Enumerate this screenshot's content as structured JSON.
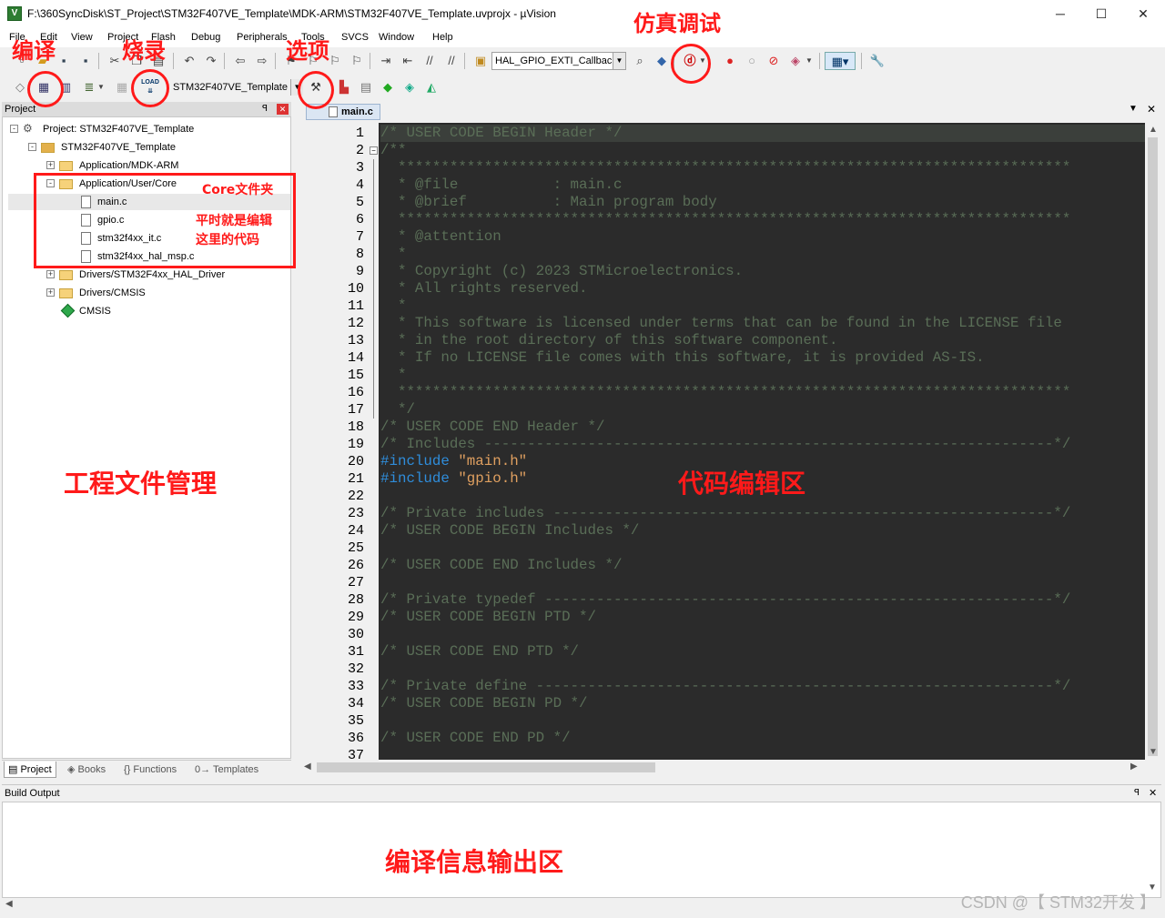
{
  "window": {
    "title": "F:\\360SyncDisk\\ST_Project\\STM32F407VE_Template\\MDK-ARM\\STM32F407VE_Template.uvprojx - µVision",
    "minimize": "─",
    "maximize": "☐",
    "close": "✕"
  },
  "menu": [
    "File",
    "Edit",
    "View",
    "Project",
    "Flash",
    "Debug",
    "Peripherals",
    "Tools",
    "SVCS",
    "Window",
    "Help"
  ],
  "toolbar": {
    "function_combo": "HAL_GPIO_EXTI_Callback",
    "target_combo": "STM32F407VE_Template",
    "load_label": "LOAD"
  },
  "project_panel": {
    "header": "Project",
    "tree": [
      {
        "label": "Project: STM32F407VE_Template",
        "kind": "project",
        "expander": "-"
      },
      {
        "label": "STM32F407VE_Template",
        "kind": "target",
        "expander": "-"
      },
      {
        "label": "Application/MDK-ARM",
        "kind": "folder",
        "expander": "+"
      },
      {
        "label": "Application/User/Core",
        "kind": "folder-open",
        "expander": "-"
      },
      {
        "label": "main.c",
        "kind": "file"
      },
      {
        "label": "gpio.c",
        "kind": "file"
      },
      {
        "label": "stm32f4xx_it.c",
        "kind": "file"
      },
      {
        "label": "stm32f4xx_hal_msp.c",
        "kind": "file"
      },
      {
        "label": "Drivers/STM32F4xx_HAL_Driver",
        "kind": "folder",
        "expander": "+"
      },
      {
        "label": "Drivers/CMSIS",
        "kind": "folder",
        "expander": "+"
      },
      {
        "label": "CMSIS",
        "kind": "component"
      }
    ],
    "tabs": [
      "Project",
      "Books",
      "Functions",
      "Templates"
    ]
  },
  "editor": {
    "active_tab": "main.c",
    "lines": [
      {
        "n": "1",
        "parts": [
          {
            "t": "/* USER CODE BEGIN Header */",
            "c": "cm"
          }
        ]
      },
      {
        "n": "2",
        "parts": [
          {
            "t": "/**",
            "c": "cm"
          }
        ]
      },
      {
        "n": "3",
        "parts": [
          {
            "t": "  ******************************************************************************",
            "c": "cm"
          }
        ]
      },
      {
        "n": "4",
        "parts": [
          {
            "t": "  * @file           : main.c",
            "c": "cm"
          }
        ]
      },
      {
        "n": "5",
        "parts": [
          {
            "t": "  * @brief          : Main program body",
            "c": "cm"
          }
        ]
      },
      {
        "n": "6",
        "parts": [
          {
            "t": "  ******************************************************************************",
            "c": "cm"
          }
        ]
      },
      {
        "n": "7",
        "parts": [
          {
            "t": "  * @attention",
            "c": "cm"
          }
        ]
      },
      {
        "n": "8",
        "parts": [
          {
            "t": "  *",
            "c": "cm"
          }
        ]
      },
      {
        "n": "9",
        "parts": [
          {
            "t": "  * Copyright (c) 2023 STMicroelectronics.",
            "c": "cm"
          }
        ]
      },
      {
        "n": "10",
        "parts": [
          {
            "t": "  * All rights reserved.",
            "c": "cm"
          }
        ]
      },
      {
        "n": "11",
        "parts": [
          {
            "t": "  *",
            "c": "cm"
          }
        ]
      },
      {
        "n": "12",
        "parts": [
          {
            "t": "  * This software is licensed under terms that can be found in the LICENSE file",
            "c": "cm"
          }
        ]
      },
      {
        "n": "13",
        "parts": [
          {
            "t": "  * in the root directory of this software component.",
            "c": "cm"
          }
        ]
      },
      {
        "n": "14",
        "parts": [
          {
            "t": "  * If no LICENSE file comes with this software, it is provided AS-IS.",
            "c": "cm"
          }
        ]
      },
      {
        "n": "15",
        "parts": [
          {
            "t": "  *",
            "c": "cm"
          }
        ]
      },
      {
        "n": "16",
        "parts": [
          {
            "t": "  ******************************************************************************",
            "c": "cm"
          }
        ]
      },
      {
        "n": "17",
        "parts": [
          {
            "t": "  */",
            "c": "cm"
          }
        ]
      },
      {
        "n": "18",
        "parts": [
          {
            "t": "/* USER CODE END Header */",
            "c": "cm"
          }
        ]
      },
      {
        "n": "19",
        "parts": [
          {
            "t": "/* Includes ------------------------------------------------------------------*/",
            "c": "cm"
          }
        ]
      },
      {
        "n": "20",
        "parts": [
          {
            "t": "#include ",
            "c": "kw"
          },
          {
            "t": "\"main.h\"",
            "c": "str"
          }
        ]
      },
      {
        "n": "21",
        "parts": [
          {
            "t": "#include ",
            "c": "kw"
          },
          {
            "t": "\"gpio.h\"",
            "c": "str"
          }
        ]
      },
      {
        "n": "22",
        "parts": []
      },
      {
        "n": "23",
        "parts": [
          {
            "t": "/* Private includes ----------------------------------------------------------*/",
            "c": "cm"
          }
        ]
      },
      {
        "n": "24",
        "parts": [
          {
            "t": "/* USER CODE BEGIN Includes */",
            "c": "cm"
          }
        ]
      },
      {
        "n": "25",
        "parts": []
      },
      {
        "n": "26",
        "parts": [
          {
            "t": "/* USER CODE END Includes */",
            "c": "cm"
          }
        ]
      },
      {
        "n": "27",
        "parts": []
      },
      {
        "n": "28",
        "parts": [
          {
            "t": "/* Private typedef -----------------------------------------------------------*/",
            "c": "cm"
          }
        ]
      },
      {
        "n": "29",
        "parts": [
          {
            "t": "/* USER CODE BEGIN PTD */",
            "c": "cm"
          }
        ]
      },
      {
        "n": "30",
        "parts": []
      },
      {
        "n": "31",
        "parts": [
          {
            "t": "/* USER CODE END PTD */",
            "c": "cm"
          }
        ]
      },
      {
        "n": "32",
        "parts": []
      },
      {
        "n": "33",
        "parts": [
          {
            "t": "/* Private define ------------------------------------------------------------*/",
            "c": "cm"
          }
        ]
      },
      {
        "n": "34",
        "parts": [
          {
            "t": "/* USER CODE BEGIN PD */",
            "c": "cm"
          }
        ]
      },
      {
        "n": "35",
        "parts": []
      },
      {
        "n": "36",
        "parts": [
          {
            "t": "/* USER CODE END PD */",
            "c": "cm"
          }
        ]
      },
      {
        "n": "37",
        "parts": []
      }
    ]
  },
  "build_output": {
    "header": "Build Output"
  },
  "annotations": {
    "compile": "编译",
    "download": "烧录",
    "options": "选项",
    "debug": "仿真调试",
    "core_folder": "Core文件夹",
    "edit_hint_1": "平时就是编辑",
    "edit_hint_2": "这里的代码",
    "project_files": "工程文件管理",
    "code_area": "代码编辑区",
    "build_area": "编译信息输出区"
  },
  "watermark": "CSDN @【 STM32开发 】",
  "colors": {
    "comment": "#5a6e57",
    "keyword": "#2f8ddb",
    "string": "#e0a060",
    "editor_bg": "#2b2b2b",
    "annotation": "#ff1a1a"
  }
}
